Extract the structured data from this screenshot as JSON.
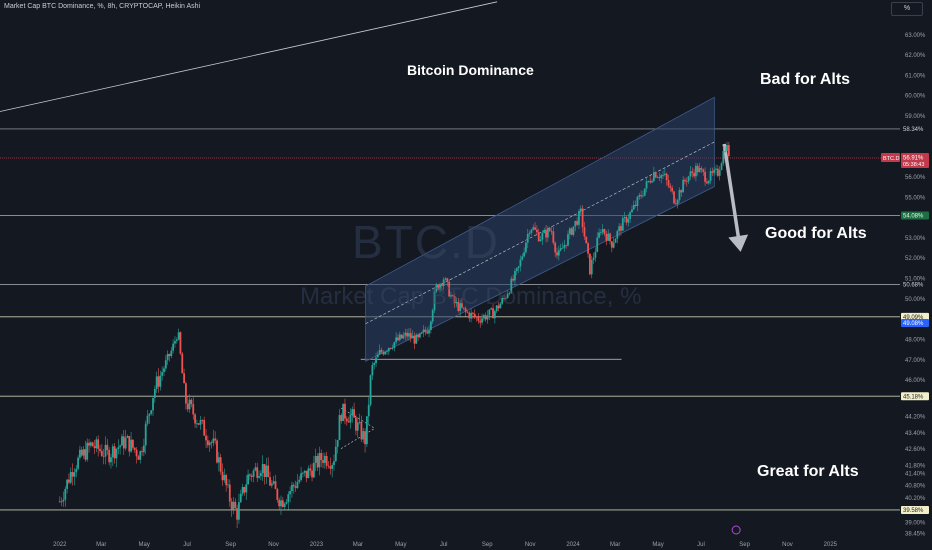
{
  "header": {
    "title": "Market Cap BTC Dominance, %, 8h, CRYPTOCAP, Heikin Ashi",
    "scale_mode": "%"
  },
  "watermark": {
    "symbol": "BTC.D",
    "name": "Market Cap BTC Dominance, %"
  },
  "annotations": {
    "chart_title": "Bitcoin Dominance",
    "bad": "Bad for Alts",
    "good": "Good for Alts",
    "great": "Great for Alts"
  },
  "colors": {
    "background": "#141821",
    "candle_up": "#26a69a",
    "candle_down": "#ef5350",
    "channel_fill": "#2a3f66",
    "channel_border": "#3e5a8a",
    "level_line": "#c8ccd6",
    "price_line": "#c2394b",
    "arrow": "#b9bcc4"
  },
  "chart_data": {
    "type": "candlestick",
    "y_scale": "linear",
    "ylim": [
      38.2,
      64.0
    ],
    "x_range": [
      "2021-12-01",
      "2025-02-15"
    ],
    "x_ticks": [
      {
        "label": "2022",
        "date": "2022-01-01"
      },
      {
        "label": "Mar",
        "date": "2022-03-01"
      },
      {
        "label": "May",
        "date": "2022-05-01"
      },
      {
        "label": "Jul",
        "date": "2022-07-01"
      },
      {
        "label": "Sep",
        "date": "2022-09-01"
      },
      {
        "label": "Nov",
        "date": "2022-11-01"
      },
      {
        "label": "2023",
        "date": "2023-01-01"
      },
      {
        "label": "Mar",
        "date": "2023-03-01"
      },
      {
        "label": "May",
        "date": "2023-05-01"
      },
      {
        "label": "Jul",
        "date": "2023-07-01"
      },
      {
        "label": "Sep",
        "date": "2023-09-01"
      },
      {
        "label": "Nov",
        "date": "2023-11-01"
      },
      {
        "label": "2024",
        "date": "2024-01-01"
      },
      {
        "label": "Mar",
        "date": "2024-03-01"
      },
      {
        "label": "May",
        "date": "2024-05-01"
      },
      {
        "label": "Jul",
        "date": "2024-07-01"
      },
      {
        "label": "Sep",
        "date": "2024-09-01"
      },
      {
        "label": "Nov",
        "date": "2024-11-01"
      },
      {
        "label": "2025",
        "date": "2025-01-01"
      }
    ],
    "y_ticks": [
      "63.00%",
      "62.00%",
      "61.00%",
      "60.00%",
      "59.00%",
      "57.00%",
      "56.00%",
      "55.00%",
      "54.00%",
      "53.00%",
      "52.00%",
      "51.00%",
      "50.00%",
      "48.00%",
      "47.00%",
      "46.00%",
      "44.20%",
      "43.40%",
      "42.60%",
      "41.80%",
      "41.40%",
      "40.80%",
      "40.20%",
      "39.00%",
      "38.45%"
    ],
    "horizontal_levels": [
      {
        "value": 58.34,
        "label": "58.34%",
        "style": "plain"
      },
      {
        "value": 54.08,
        "label": "54.08%",
        "style": "green"
      },
      {
        "value": 50.68,
        "label": "50.68%",
        "style": "plain"
      },
      {
        "value": 49.09,
        "label": "49.09%",
        "style": "yellow"
      },
      {
        "value": 45.18,
        "label": "45.18%",
        "style": "yellow"
      },
      {
        "value": 39.58,
        "label": "39.58%",
        "style": "yellow"
      }
    ],
    "price_marker": {
      "symbol": "BTC.D",
      "value": 56.91,
      "label": "56.91%",
      "countdown": "05:38:43"
    },
    "second_marker": {
      "value": 49.08,
      "label": "49.08%"
    },
    "channel": {
      "start_date": "2023-03-12",
      "end_date": "2024-07-20",
      "top_start": 50.6,
      "top_end": 59.9,
      "bottom_start": 46.9,
      "bottom_end": 55.5
    },
    "series": [
      {
        "type": "candlestick",
        "anchors": [
          [
            "2022-01-01",
            40.0
          ],
          [
            "2022-01-20",
            41.7
          ],
          [
            "2022-02-15",
            42.8
          ],
          [
            "2022-03-10",
            42.3
          ],
          [
            "2022-04-05",
            43.0
          ],
          [
            "2022-04-25",
            42.3
          ],
          [
            "2022-05-15",
            45.5
          ],
          [
            "2022-06-10",
            47.5
          ],
          [
            "2022-06-18",
            48.4
          ],
          [
            "2022-06-28",
            45.0
          ],
          [
            "2022-07-20",
            43.8
          ],
          [
            "2022-08-10",
            42.6
          ],
          [
            "2022-08-30",
            40.2
          ],
          [
            "2022-09-10",
            39.4
          ],
          [
            "2022-09-25",
            41.2
          ],
          [
            "2022-10-15",
            41.8
          ],
          [
            "2022-11-01",
            40.6
          ],
          [
            "2022-11-12",
            40.0
          ],
          [
            "2022-12-05",
            41.0
          ],
          [
            "2022-12-20",
            41.4
          ],
          [
            "2023-01-10",
            42.2
          ],
          [
            "2023-01-25",
            42.0
          ],
          [
            "2023-02-05",
            44.4
          ],
          [
            "2023-02-20",
            44.2
          ],
          [
            "2023-03-05",
            43.4
          ],
          [
            "2023-03-12",
            43.0
          ],
          [
            "2023-03-20",
            46.5
          ],
          [
            "2023-04-01",
            47.3
          ],
          [
            "2023-04-20",
            47.8
          ],
          [
            "2023-05-10",
            48.2
          ],
          [
            "2023-05-25",
            47.9
          ],
          [
            "2023-06-10",
            48.6
          ],
          [
            "2023-06-20",
            50.5
          ],
          [
            "2023-07-01",
            51.0
          ],
          [
            "2023-07-15",
            49.8
          ],
          [
            "2023-08-01",
            49.3
          ],
          [
            "2023-08-20",
            49.0
          ],
          [
            "2023-09-10",
            49.3
          ],
          [
            "2023-09-25",
            50.0
          ],
          [
            "2023-10-15",
            51.4
          ],
          [
            "2023-11-01",
            53.6
          ],
          [
            "2023-11-15",
            53.0
          ],
          [
            "2023-12-01",
            53.4
          ],
          [
            "2023-12-10",
            52.0
          ],
          [
            "2024-01-01",
            53.5
          ],
          [
            "2024-01-12",
            54.2
          ],
          [
            "2024-01-25",
            51.4
          ],
          [
            "2024-02-10",
            53.5
          ],
          [
            "2024-02-25",
            52.7
          ],
          [
            "2024-03-10",
            53.6
          ],
          [
            "2024-03-25",
            54.3
          ],
          [
            "2024-04-10",
            55.3
          ],
          [
            "2024-04-25",
            56.2
          ],
          [
            "2024-05-10",
            56.0
          ],
          [
            "2024-05-25",
            54.8
          ],
          [
            "2024-06-10",
            55.9
          ],
          [
            "2024-06-25",
            56.4
          ],
          [
            "2024-07-10",
            55.9
          ],
          [
            "2024-07-25",
            56.2
          ],
          [
            "2024-08-05",
            57.6
          ],
          [
            "2024-08-12",
            56.9
          ]
        ]
      }
    ]
  }
}
